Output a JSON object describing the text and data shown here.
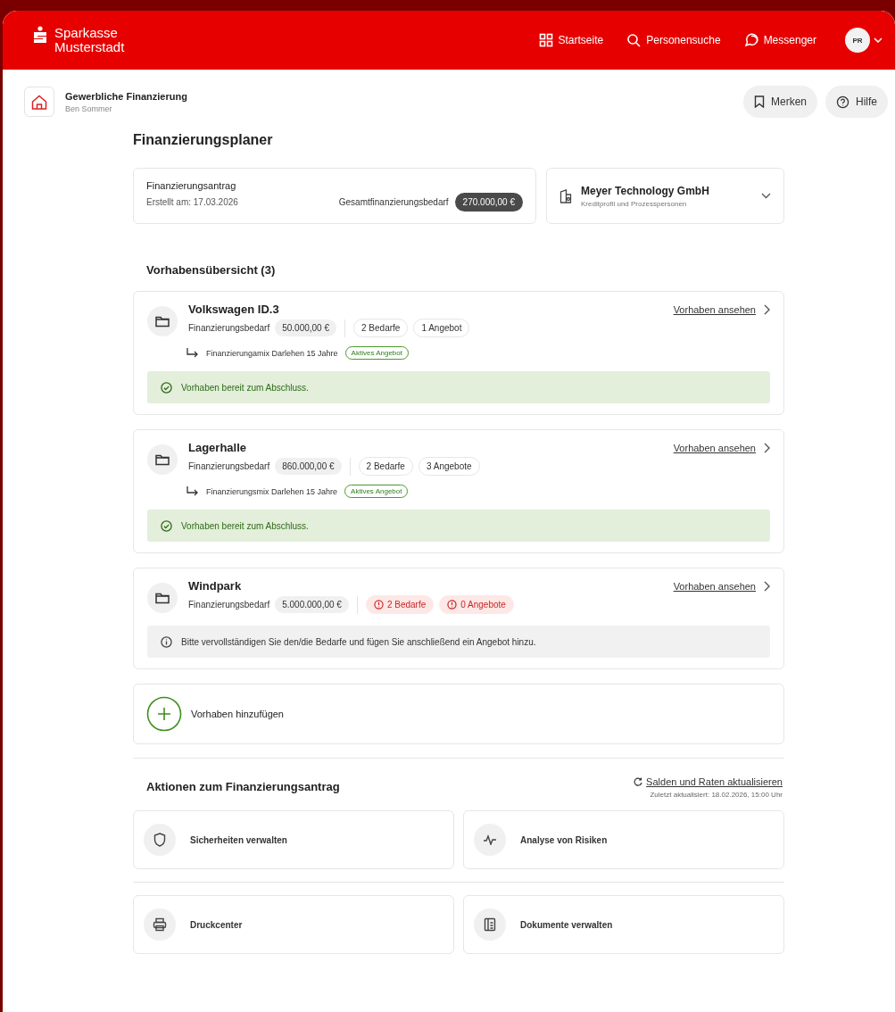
{
  "header": {
    "brand": [
      "Sparkasse",
      "Musterstadt"
    ],
    "nav": [
      {
        "label": "Startseite"
      },
      {
        "label": "Personensuche"
      },
      {
        "label": "Messenger"
      }
    ],
    "avatar": "PR"
  },
  "context": {
    "title": "Gewerbliche Finanzierung",
    "subtitle": "Ben Sommer",
    "buttons": [
      {
        "label": "Merken"
      },
      {
        "label": "Hilfe"
      }
    ]
  },
  "page_title": "Finanzierungsplaner",
  "application": {
    "title": "Finanzierungsantrag",
    "created": "Erstellt am: 17.03.2026",
    "total_label": "Gesamtfinanzierungsbedarf",
    "total": "270.000,00 €"
  },
  "customer": {
    "name": "Meyer Technology GmbH",
    "subtitle": "Kreditprofil und Prozesspersonen"
  },
  "overview_title": "Vorhabensübersicht (3)",
  "projects": [
    {
      "name": "Volkswagen ID.3",
      "need_label": "Finanzierungsbedarf",
      "amount": "50.000,00 €",
      "chips": [
        {
          "label": "2 Bedarfe",
          "warning": false
        },
        {
          "label": "1 Angebot",
          "warning": false
        }
      ],
      "mix": {
        "text": "Finanzierungamix Darlehen 15 Jahre",
        "badge": "Aktives Angebot"
      },
      "notice": {
        "kind": "success",
        "text": "Vorhaben bereit zum Abschluss."
      },
      "link": "Vorhaben ansehen"
    },
    {
      "name": "Lagerhalle",
      "need_label": "Finanzierungsbedarf",
      "amount": "860.000,00 €",
      "chips": [
        {
          "label": "2 Bedarfe",
          "warning": false
        },
        {
          "label": "3 Angebote",
          "warning": false
        }
      ],
      "mix": {
        "text": "Finanzierungsmix Darlehen 15 Jahre",
        "badge": "Aktives Angebot"
      },
      "notice": {
        "kind": "success",
        "text": "Vorhaben bereit zum Abschluss."
      },
      "link": "Vorhaben ansehen"
    },
    {
      "name": "Windpark",
      "need_label": "Finanzierungsbedarf",
      "amount": "5.000.000,00 €",
      "chips": [
        {
          "label": "2 Bedarfe",
          "warning": true
        },
        {
          "label": "0 Angebote",
          "warning": true
        }
      ],
      "notice": {
        "kind": "info",
        "text": "Bitte vervollständigen Sie den/die Bedarfe und fügen Sie anschließend ein Angebot hinzu."
      },
      "link": "Vorhaben ansehen"
    }
  ],
  "add_label": "Vorhaben hinzufügen",
  "actions": {
    "title": "Aktionen zum Finanzierungsantrag",
    "refresh": "Salden und Raten aktualisieren",
    "updated": "Zuletzt aktualisiert: 18.02.2026, 15:00 Uhr",
    "items": [
      {
        "label": "Sicherheiten verwalten"
      },
      {
        "label": "Analyse von Risiken"
      },
      {
        "label": "Druckcenter"
      },
      {
        "label": "Dokumente verwalten"
      }
    ]
  }
}
